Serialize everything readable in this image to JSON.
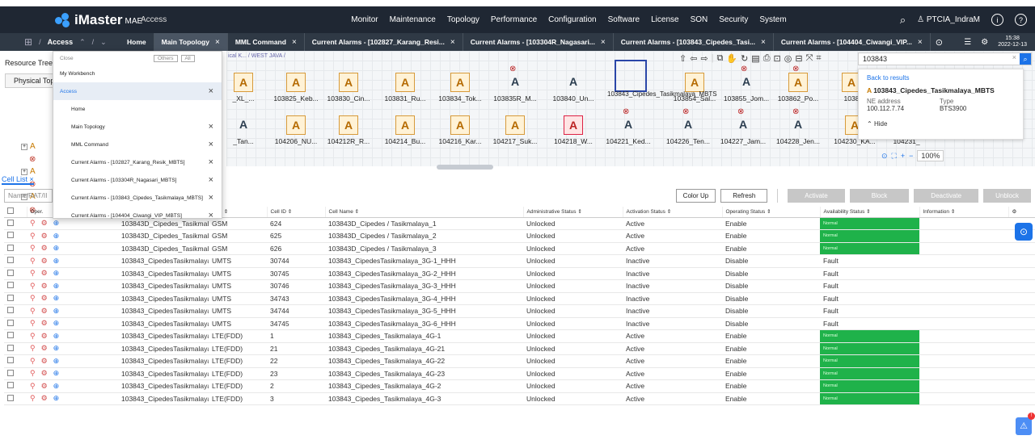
{
  "topbar": {
    "brand": "iMaster",
    "brand_suffix": "MAE",
    "access": "Access",
    "menu": [
      "Monitor",
      "Maintenance",
      "Topology",
      "Performance",
      "Configuration",
      "Software",
      "License",
      "SON",
      "Security",
      "System"
    ],
    "user": "PTCIA_IndraM"
  },
  "tabbar": {
    "access": "Access",
    "tabs": [
      "Home",
      "Main Topology",
      "MML Command",
      "Current Alarms - [102827_Karang_Resi...",
      "Current Alarms - [103304R_Nagasari...",
      "Current Alarms - [103843_Cipedes_Tasi...",
      "Current Alarms - [104404_Ciwangi_VIP..."
    ],
    "time": "15:38",
    "date": "2022-12-13"
  },
  "tree": {
    "header": "Resource Tree",
    "tab": "Physical Top"
  },
  "dropdown": {
    "close": "Close",
    "others": "Others",
    "all": "All",
    "group1": "My Workbench",
    "group2": "Access",
    "items": [
      "Home",
      "Main Topology",
      "MML Command",
      "Current Alarms - [102827_Karang_Resik_MBTS]",
      "Current Alarms - [103304R_Nagasari_MBTS]",
      "Current Alarms - [103843_Cipedes_Tasikmalaya_MBTS]",
      "Current Alarms - [104404_Ciwangi_VIP_MBTS]"
    ]
  },
  "topology": {
    "breadcrumb": "ical K... / WEST JAVA /",
    "row1": [
      "_XL_...",
      "103825_Keb...",
      "103830_Cin...",
      "103831_Ru...",
      "103834_Tok...",
      "103835R_M...",
      "103840_Un...",
      "",
      "103854_Sal...",
      "103855_Jom...",
      "103862_Po...",
      "1038"
    ],
    "row2": [
      "_Tan...",
      "104206_NU...",
      "104212R_R...",
      "104214_Bu...",
      "104216_Kar...",
      "104217_Suk...",
      "104218_W...",
      "104221_Ked...",
      "104226_Ten...",
      "104227_Jam...",
      "104228_Jen...",
      "104230_KA...",
      "104231_"
    ],
    "selected_label": "103843_Cipedes_Tasikmalaya_MBTS",
    "zoom": "100%"
  },
  "search": {
    "value": "103843",
    "back": "Back to results",
    "result_name": "103843_Cipedes_Tasikmalaya_MBTS",
    "ne_label": "NE address",
    "type_label": "Type",
    "ne_value": "100.112.7.74",
    "type_value": "BTS3900",
    "hide": "Hide"
  },
  "celllist": {
    "tab": "Cell List",
    "filter_placeholder": "Name/RAT/II",
    "buttons": {
      "colorup": "Color Up",
      "refresh": "Refresh",
      "activate": "Activate",
      "block": "Block",
      "deactivate": "Deactivate",
      "unblock": "Unblock"
    },
    "columns": [
      "Oper.",
      "",
      "RAT ⇕",
      "Cell ID ⇕",
      "Cell Name ⇕",
      "Administrative Status ⇕",
      "Activation Status ⇕",
      "Operating Status ⇕",
      "Availability Status ⇕",
      "Information ⇕"
    ],
    "rows": [
      [
        "103843D_Cipedes_Tasikmalaya_2G@...",
        "GSM",
        "624",
        "103843D_Cipedes / Tasikmalaya_1",
        "Unlocked",
        "Active",
        "Enable",
        "Normal"
      ],
      [
        "103843D_Cipedes_Tasikmalaya_2G@...",
        "GSM",
        "625",
        "103843D_Cipedes / Tasikmalaya_2",
        "Unlocked",
        "Active",
        "Enable",
        "Normal"
      ],
      [
        "103843D_Cipedes_Tasikmalaya_2G@...",
        "GSM",
        "626",
        "103843D_Cipedes / Tasikmalaya_3",
        "Unlocked",
        "Active",
        "Enable",
        "Normal"
      ],
      [
        "103843_CipedesTasikmalaya_3G@10...",
        "UMTS",
        "30744",
        "103843_CipedesTasikmalaya_3G-1_HHH",
        "Unlocked",
        "Inactive",
        "Disable",
        "Fault"
      ],
      [
        "103843_CipedesTasikmalaya_3G@10...",
        "UMTS",
        "30745",
        "103843_CipedesTasikmalaya_3G-2_HHH",
        "Unlocked",
        "Inactive",
        "Disable",
        "Fault"
      ],
      [
        "103843_CipedesTasikmalaya_3G@10...",
        "UMTS",
        "30746",
        "103843_CipedesTasikmalaya_3G-3_HHH",
        "Unlocked",
        "Inactive",
        "Disable",
        "Fault"
      ],
      [
        "103843_CipedesTasikmalaya_3G@10...",
        "UMTS",
        "34743",
        "103843_CipedesTasikmalaya_3G-4_HHH",
        "Unlocked",
        "Inactive",
        "Disable",
        "Fault"
      ],
      [
        "103843_CipedesTasikmalaya_3G@10...",
        "UMTS",
        "34744",
        "103843_CipedesTasikmalaya_3G-5_HHH",
        "Unlocked",
        "Inactive",
        "Disable",
        "Fault"
      ],
      [
        "103843_CipedesTasikmalaya_3G@10...",
        "UMTS",
        "34745",
        "103843_CipedesTasikmalaya_3G-6_HHH",
        "Unlocked",
        "Inactive",
        "Disable",
        "Fault"
      ],
      [
        "103843_CipedesTasikmalaya_4G@10...",
        "LTE(FDD)",
        "1",
        "103843_Cipedes_Tasikmalaya_4G-1",
        "Unlocked",
        "Active",
        "Enable",
        "Normal"
      ],
      [
        "103843_CipedesTasikmalaya_4G@10...",
        "LTE(FDD)",
        "21",
        "103843_Cipedes_Tasikmalaya_4G-21",
        "Unlocked",
        "Active",
        "Enable",
        "Normal"
      ],
      [
        "103843_CipedesTasikmalaya_4G@10...",
        "LTE(FDD)",
        "22",
        "103843_Cipedes_Tasikmalaya_4G-22",
        "Unlocked",
        "Active",
        "Enable",
        "Normal"
      ],
      [
        "103843_CipedesTasikmalaya_4G@10...",
        "LTE(FDD)",
        "23",
        "103843_Cipedes_Tasikmalaya_4G-23",
        "Unlocked",
        "Active",
        "Enable",
        "Normal"
      ],
      [
        "103843_CipedesTasikmalaya_4G@10...",
        "LTE(FDD)",
        "2",
        "103843_Cipedes_Tasikmalaya_4G-2",
        "Unlocked",
        "Active",
        "Enable",
        "Normal"
      ],
      [
        "103843_CipedesTasikmalaya_4G@10...",
        "LTE(FDD)",
        "3",
        "103843_Cipedes_Tasikmalaya_4G-3",
        "Unlocked",
        "Active",
        "Enable",
        "Normal"
      ]
    ]
  },
  "colors": {
    "topbar": "#1f2733",
    "tabbar": "#2f3945",
    "accent": "#1c73e8",
    "normal": "#1fb24a"
  }
}
